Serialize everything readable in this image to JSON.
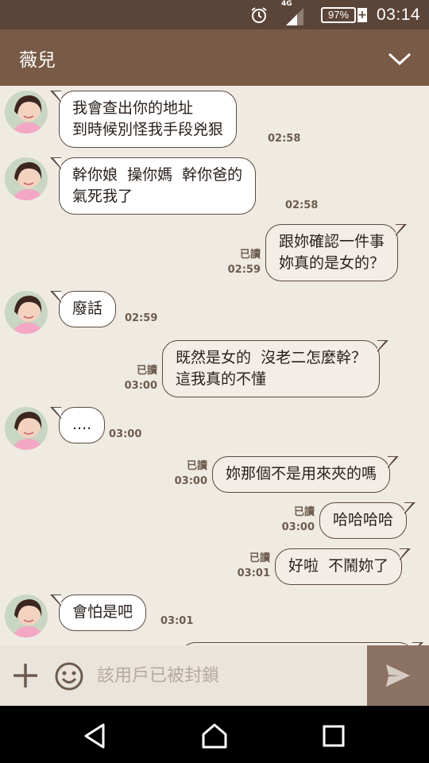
{
  "status_bar": {
    "network": "4G",
    "battery": "97%",
    "time": "03:14",
    "icons": [
      "alarm-icon",
      "signal-icon",
      "battery-icon"
    ]
  },
  "header": {
    "title": "薇兒",
    "collapse_icon": "chevron-down-icon"
  },
  "messages": [
    {
      "side": "in",
      "text": "我會查出你的地址\n到時候別怪我手段兇狠",
      "time": "02:58"
    },
    {
      "side": "in",
      "text": "幹你娘  操你媽  幹你爸的\n氣死我了",
      "time": "02:58"
    },
    {
      "side": "out",
      "text": "跟妳確認一件事\n妳真的是女的？",
      "read": "已讀",
      "time": "02:59"
    },
    {
      "side": "in",
      "text": "廢話",
      "time": "02:59"
    },
    {
      "side": "out",
      "text": "既然是女的  沒老二怎麼幹？\n這我真的不懂",
      "read": "已讀",
      "time": "03:00"
    },
    {
      "side": "in",
      "text": "....",
      "time": "03:00"
    },
    {
      "side": "out",
      "text": "妳那個不是用來夾的嗎",
      "read": "已讀",
      "time": "03:00"
    },
    {
      "side": "out",
      "text": "哈哈哈哈",
      "read": "已讀",
      "time": "03:00"
    },
    {
      "side": "out",
      "text": "好啦  不鬧妳了",
      "read": "已讀",
      "time": "03:01"
    },
    {
      "side": "in",
      "text": "會怕是吧",
      "time": "03:01"
    }
  ],
  "input_bar": {
    "placeholder": "該用戶已被封鎖",
    "icons": [
      "plus-icon",
      "emoji-icon",
      "send-icon"
    ]
  },
  "nav_bar": {
    "icons": [
      "back-icon",
      "home-icon",
      "recents-icon"
    ]
  },
  "colors": {
    "status_bar": "#5b4538",
    "header": "#785a46",
    "chat_background": "#efeae2",
    "bubble_border": "#5c4a3e",
    "send_button": "#8b7263"
  }
}
